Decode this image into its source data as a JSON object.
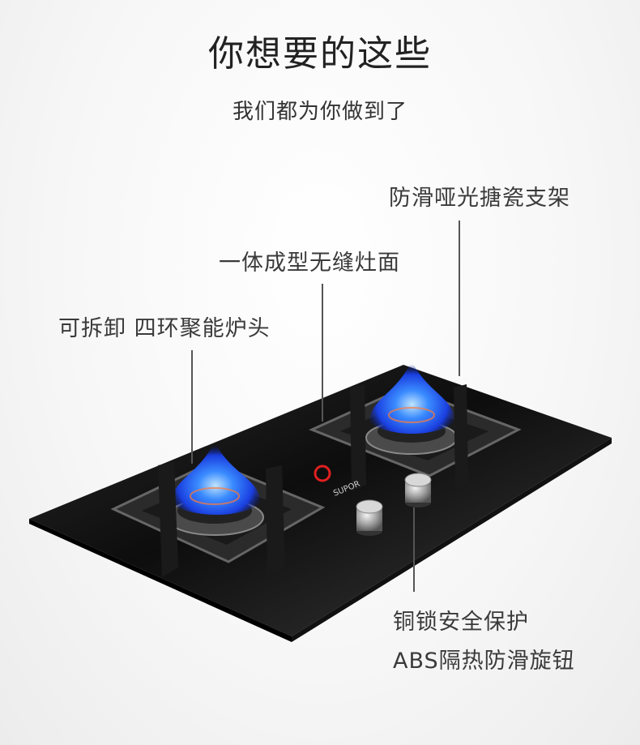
{
  "heading": {
    "title": "你想要的这些",
    "subtitle": "我们都为你做到了"
  },
  "callouts": {
    "bracket": "防滑哑光搪瓷支架",
    "surface": "一体成型无缝灶面",
    "burner": "可拆卸 四环聚能炉头",
    "knob_line1": "铜锁安全保护",
    "knob_line2": "ABS隔热防滑旋钮"
  },
  "panel": {
    "brand": "SUPOR"
  },
  "colors": {
    "flame": "#1f5bff",
    "glass": "#151515",
    "text": "#333333"
  }
}
